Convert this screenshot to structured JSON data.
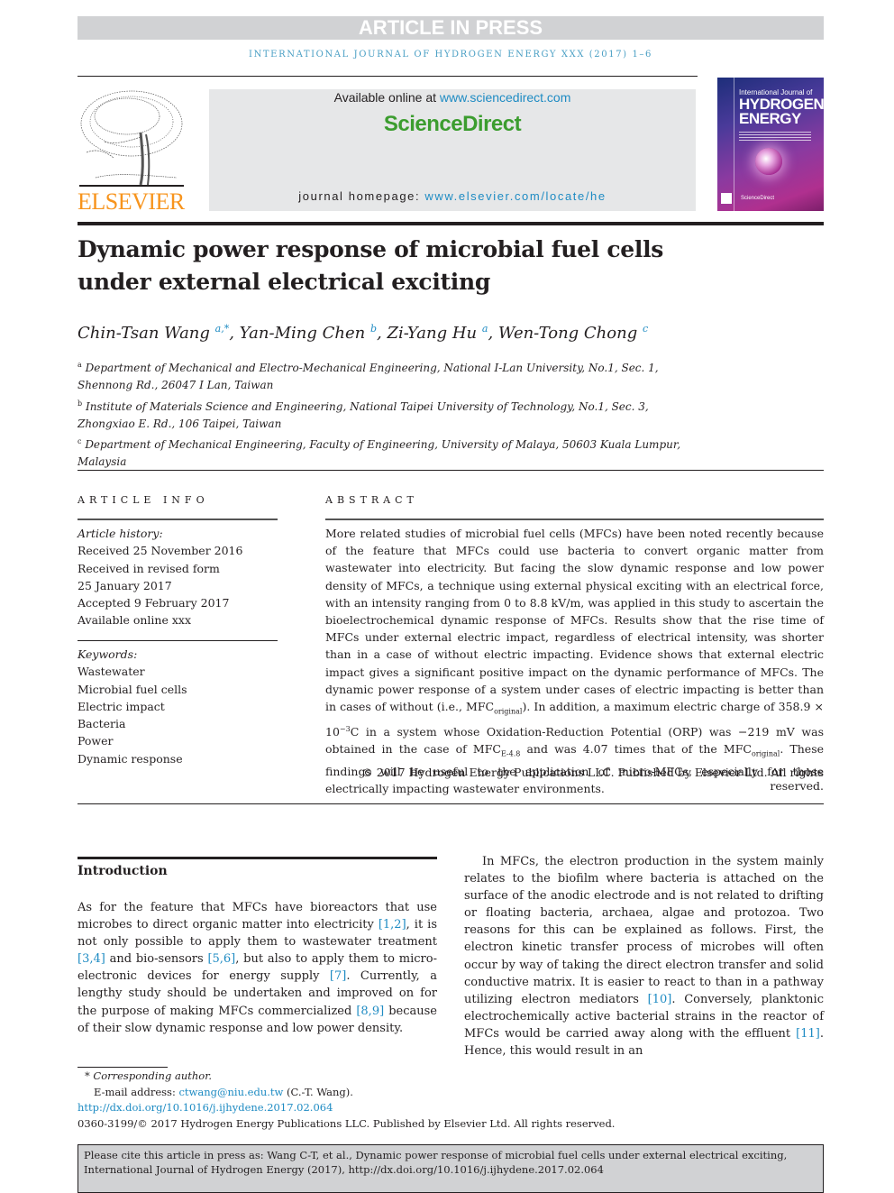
{
  "banner": {
    "label": "ARTICLE IN PRESS"
  },
  "journal_running_head": "INTERNATIONAL JOURNAL OF HYDROGEN ENERGY XXX (2017) 1–6",
  "publisher_logo": {
    "wordmark": "ELSEVIER",
    "color": "#f7941d"
  },
  "sciencedirect": {
    "available_prefix": "Available online at ",
    "available_link": "www.sciencedirect.com",
    "brand": "ScienceDirect",
    "brand_color": "#3c9d2f",
    "homepage_prefix": "journal homepage: ",
    "homepage_link": "www.elsevier.com/locate/he",
    "link_color": "#1e8bc3"
  },
  "journal_cover": {
    "line1": "International Journal of",
    "line2": "HYDROGEN",
    "line3": "ENERGY",
    "footer": "ScienceDirect"
  },
  "article": {
    "title_line1": "Dynamic power response of microbial fuel cells",
    "title_line2": "under external electrical exciting",
    "authors": [
      {
        "name": "Chin-Tsan Wang",
        "sup": "a,*"
      },
      {
        "name": "Yan-Ming Chen",
        "sup": "b"
      },
      {
        "name": "Zi-Yang Hu",
        "sup": "a"
      },
      {
        "name": "Wen-Tong Chong",
        "sup": "c"
      }
    ],
    "affiliations": [
      {
        "sup": "a",
        "text": "Department of Mechanical and Electro-Mechanical Engineering, National I-Lan University, No.1, Sec. 1, Shennong Rd., 26047 I Lan, Taiwan"
      },
      {
        "sup": "b",
        "text": "Institute of Materials Science and Engineering, National Taipei University of Technology, No.1, Sec. 3, Zhongxiao E. Rd., 106 Taipei, Taiwan"
      },
      {
        "sup": "c",
        "text": "Department of Mechanical Engineering, Faculty of Engineering, University of Malaya, 50603 Kuala Lumpur, Malaysia"
      }
    ]
  },
  "article_info": {
    "heading": "ARTICLE INFO",
    "history_label": "Article history:",
    "history": [
      "Received 25 November 2016",
      "Received in revised form",
      "25 January 2017",
      "Accepted 9 February 2017",
      "Available online xxx"
    ],
    "keywords_label": "Keywords:",
    "keywords": [
      "Wastewater",
      "Microbial fuel cells",
      "Electric impact",
      "Bacteria",
      "Power",
      "Dynamic response"
    ]
  },
  "abstract": {
    "heading": "ABSTRACT",
    "p1": "More related studies of microbial fuel cells (MFCs) have been noted recently because of the feature that MFCs could use bacteria to convert organic matter from wastewater into electricity. But facing the slow dynamic response and low power density of MFCs, a technique using external physical exciting with an electrical force, with an intensity ranging from 0 to 8.8 kV/m, was applied in this study to ascertain the bioelectrochemical dynamic response of MFCs. Results show that the rise time of MFCs under external electric impact, regardless of electrical intensity, was shorter than in a case of without electric impacting. Evidence shows that external electric impact gives a significant positive impact on the dynamic performance of MFCs. The dynamic power response of a system under cases of electric impacting is better than in cases of without (i.e., MFC",
    "sub_original": "original",
    "p2": "). In addition, a maximum electric charge of 358.9 × 10",
    "sup_exp": "−3",
    "p3": "C in a system whose Oxidation-Reduction Potential (ORP) was −219 mV was obtained in the case of MFC",
    "sub_e48": "E-4.8",
    "p4": " and was 4.07 times that of the MFC",
    "p5": ". These findings will be useful to the application of micro-MFCs, especially for those electrically impacting wastewater environments.",
    "copyright": "© 2017 Hydrogen Energy Publications LLC. Published by Elsevier Ltd. All rights reserved."
  },
  "introduction": {
    "heading": "Introduction",
    "col1": [
      {
        "t": "As for the feature that MFCs have bioreactors that use microbes to direct organic matter into electricity "
      },
      {
        "r": "[1,2]"
      },
      {
        "t": ", it is not only possible to apply them to wastewater treatment "
      },
      {
        "r": "[3,4]"
      },
      {
        "t": " and bio-sensors "
      },
      {
        "r": "[5,6]"
      },
      {
        "t": ", but also to apply them to micro-electronic devices for energy supply "
      },
      {
        "r": "[7]"
      },
      {
        "t": ". Currently, a lengthy study should be undertaken and improved on for the purpose of making MFCs commercialized "
      },
      {
        "r": "[8,9]"
      },
      {
        "t": " because of their slow dynamic response and low power density."
      }
    ],
    "col2": [
      {
        "t": "In MFCs, the electron production in the system mainly relates to the biofilm where bacteria is attached on the surface of the anodic electrode and is not related to drifting or floating bacteria, archaea, algae and protozoa. Two reasons for this can be explained as follows. First, the electron kinetic transfer process of microbes will often occur by way of taking the direct electron transfer and solid conductive matrix. It is easier to react to than in a pathway utilizing electron mediators "
      },
      {
        "r": "[10]"
      },
      {
        "t": ". Conversely, planktonic electrochemically active bacterial strains in the reactor of MFCs would be carried away along with the effluent "
      },
      {
        "r": "[11]"
      },
      {
        "t": ". Hence, this would result in an"
      }
    ]
  },
  "footnotes": {
    "corresponding": "* Corresponding author.",
    "email_label": "E-mail address: ",
    "email": "ctwang@niu.edu.tw",
    "email_suffix": " (C.-T. Wang).",
    "doi": "http://dx.doi.org/10.1016/j.ijhydene.2017.02.064",
    "issn_copyright": "0360-3199/© 2017 Hydrogen Energy Publications LLC. Published by Elsevier Ltd. All rights reserved."
  },
  "citation_box": {
    "text": "Please cite this article in press as: Wang C-T, et al., Dynamic power response of microbial fuel cells under external electrical exciting, International Journal of Hydrogen Energy (2017), http://dx.doi.org/10.1016/j.ijhydene.2017.02.064"
  }
}
